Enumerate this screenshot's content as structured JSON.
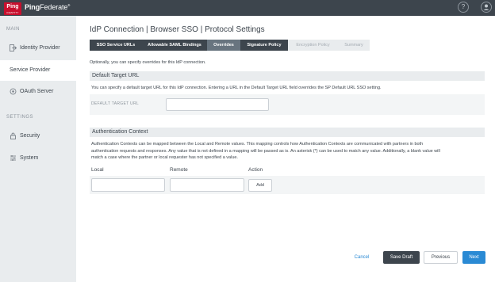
{
  "header": {
    "logo_text": "Ping",
    "logo_subtext": "IDENTITY",
    "product_name_bold": "Ping",
    "product_name_light": "Federate",
    "trademark": "®",
    "help_icon": "question-icon",
    "user_icon": "user-icon"
  },
  "sidebar": {
    "main_heading": "MAIN",
    "settings_heading": "SETTINGS",
    "items": [
      {
        "label": "Identity Provider",
        "icon": "identity-provider-icon"
      },
      {
        "label": "Service Provider",
        "icon": "service-provider-icon",
        "active": true
      },
      {
        "label": "OAuth Server",
        "icon": "oauth-icon"
      },
      {
        "label": "Security",
        "icon": "lock-icon"
      },
      {
        "label": "System",
        "icon": "gear-icon"
      }
    ]
  },
  "page": {
    "title": "IdP Connection | Browser SSO | Protocol Settings",
    "intro": "Optionally, you can specify overrides for this IdP connection."
  },
  "tabs": [
    {
      "label": "SSO Service URLs",
      "state": "done"
    },
    {
      "label": "Allowable SAML Bindings",
      "state": "done"
    },
    {
      "label": "Overrides",
      "state": "current"
    },
    {
      "label": "Signature Policy",
      "state": "done"
    },
    {
      "label": "Encryption Policy",
      "state": "pending"
    },
    {
      "label": "Summary",
      "state": "pending"
    }
  ],
  "default_target": {
    "heading": "Default Target URL",
    "description": "You can specify a default target URL for this IdP connection. Entering a URL in the Default Target URL field overrides the SP Default URL SSO setting.",
    "field_label": "DEFAULT TARGET URL",
    "value": ""
  },
  "auth_context": {
    "heading": "Authentication Context",
    "description_1": "Authentication Contexts can be mapped between the Local and Remote values. This mapping controls how Authentication Contexts are communicated with partners in both",
    "description_2": "authentication requests and responses. Any value that is not defined in a mapping will be passed as is. An asterisk (*) can be used to match any value. Additionally, a blank value will",
    "description_3": "match a case where the partner or local requester has not specified a value.",
    "col_local": "Local",
    "col_remote": "Remote",
    "col_action": "Action",
    "local_value": "",
    "remote_value": "",
    "add_label": "Add"
  },
  "footer": {
    "cancel_label": "Cancel",
    "save_draft_label": "Save Draft",
    "previous_label": "Previous",
    "next_label": "Next"
  },
  "colors": {
    "header_bg": "#3d454d",
    "brand_red": "#c8102e",
    "accent_blue": "#2a8ad4",
    "sidebar_bg": "#e9ecee"
  }
}
